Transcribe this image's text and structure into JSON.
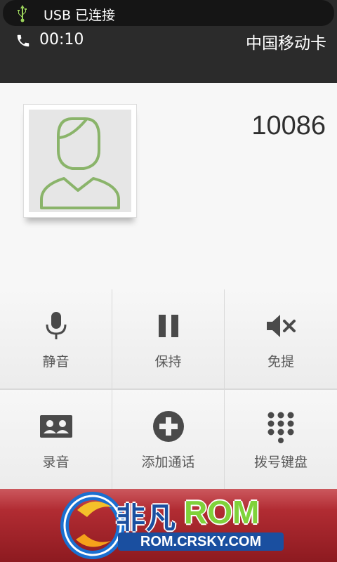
{
  "status_bar": {
    "usb_text": "USB 已连接",
    "call_timer": "00:10",
    "carrier": "中国移动卡"
  },
  "caller": {
    "number": "10086",
    "avatar_icon": "person-icon"
  },
  "buttons": [
    {
      "label": "静音",
      "icon": "microphone-icon"
    },
    {
      "label": "保持",
      "icon": "pause-icon"
    },
    {
      "label": "免提",
      "icon": "speaker-mute-icon"
    },
    {
      "label": "录音",
      "icon": "record-icon"
    },
    {
      "label": "添加通话",
      "icon": "add-call-icon"
    },
    {
      "label": "拨号键盘",
      "icon": "dialpad-icon"
    }
  ],
  "banner": {
    "logo_cn": "非凡",
    "logo_rom": "ROM",
    "logo_url": "ROM.CRSKY.COM"
  },
  "colors": {
    "accent_green": "#8ab46a",
    "icon_gray": "#4a4a4a",
    "banner_red": "#b32a31",
    "logo_blue": "#1a4fa0"
  }
}
